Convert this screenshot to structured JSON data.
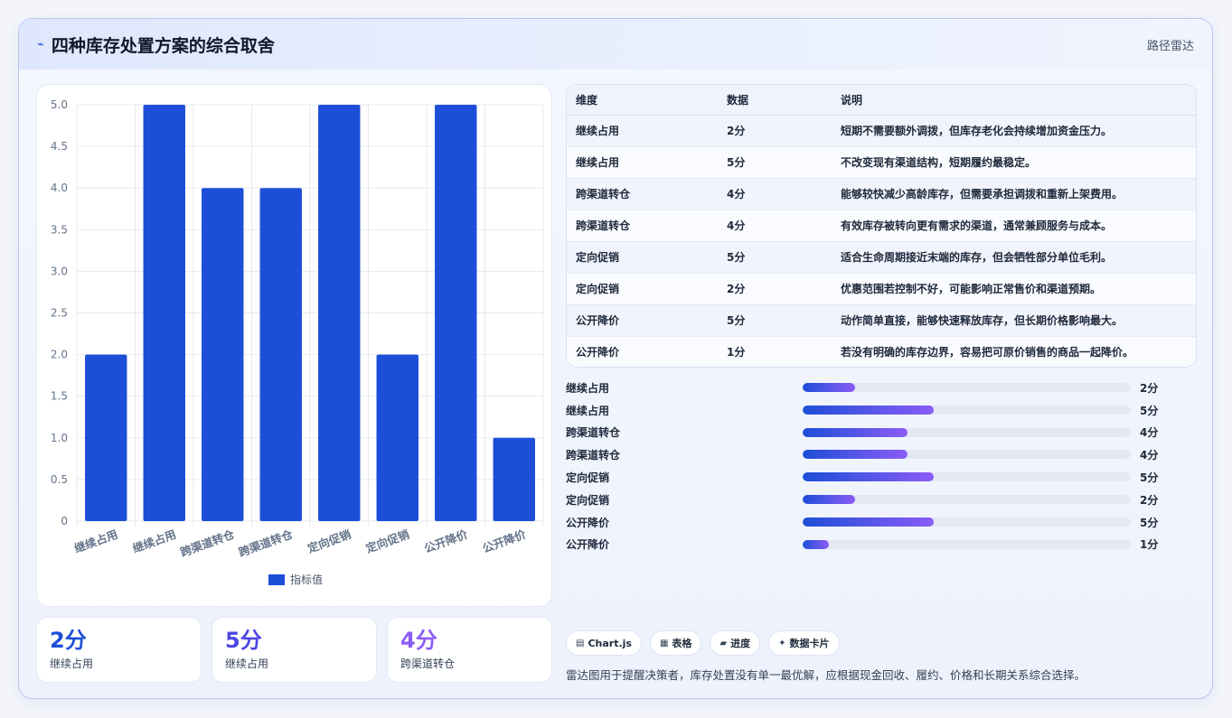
{
  "header": {
    "title": "四种库存处置方案的综合取舍",
    "tag": "路径雷达"
  },
  "chart_data": {
    "type": "bar",
    "categories": [
      "继续占用",
      "继续占用",
      "跨渠道转仓",
      "跨渠道转仓",
      "定向促销",
      "定向促销",
      "公开降价",
      "公开降价"
    ],
    "series": [
      {
        "name": "指标值",
        "values": [
          2,
          5,
          4,
          4,
          5,
          2,
          5,
          1
        ]
      }
    ],
    "ylim": [
      0,
      5
    ],
    "yticks": [
      "0",
      "0.5",
      "1.0",
      "1.5",
      "2.0",
      "2.5",
      "3.0",
      "3.5",
      "4.0",
      "4.5",
      "5.0"
    ],
    "grid": true,
    "legend": "bottom",
    "color": "#1d4ed8"
  },
  "kpis": [
    {
      "value": "2分",
      "label": "继续占用",
      "color": "#1d4ed8"
    },
    {
      "value": "5分",
      "label": "继续占用",
      "color": "#4f46e5"
    },
    {
      "value": "4分",
      "label": "跨渠道转仓",
      "color": "#8b5cf6"
    }
  ],
  "table": {
    "headers": [
      "维度",
      "数据",
      "说明"
    ],
    "rows": [
      [
        "继续占用",
        "2分",
        "短期不需要额外调拨，但库存老化会持续增加资金压力。"
      ],
      [
        "继续占用",
        "5分",
        "不改变现有渠道结构，短期履约最稳定。"
      ],
      [
        "跨渠道转仓",
        "4分",
        "能够较快减少高龄库存，但需要承担调拨和重新上架费用。"
      ],
      [
        "跨渠道转仓",
        "4分",
        "有效库存被转向更有需求的渠道，通常兼顾服务与成本。"
      ],
      [
        "定向促销",
        "5分",
        "适合生命周期接近末端的库存，但会牺牲部分单位毛利。"
      ],
      [
        "定向促销",
        "2分",
        "优惠范围若控制不好，可能影响正常售价和渠道预期。"
      ],
      [
        "公开降价",
        "5分",
        "动作简单直接，能够快速释放库存，但长期价格影响最大。"
      ],
      [
        "公开降价",
        "1分",
        "若没有明确的库存边界，容易把可原价销售的商品一起降价。"
      ]
    ]
  },
  "progress": [
    {
      "label": "继续占用",
      "value": 2,
      "text": "2分"
    },
    {
      "label": "继续占用",
      "value": 5,
      "text": "5分"
    },
    {
      "label": "跨渠道转仓",
      "value": 4,
      "text": "4分"
    },
    {
      "label": "跨渠道转仓",
      "value": 4,
      "text": "4分"
    },
    {
      "label": "定向促销",
      "value": 5,
      "text": "5分"
    },
    {
      "label": "定向促销",
      "value": 2,
      "text": "2分"
    },
    {
      "label": "公开降价",
      "value": 5,
      "text": "5分"
    },
    {
      "label": "公开降价",
      "value": 1,
      "text": "1分"
    }
  ],
  "progress_max": 12.5,
  "chips": [
    {
      "icon": "chart-icon",
      "glyph": "▤",
      "label": "Chart.js"
    },
    {
      "icon": "table-icon",
      "glyph": "▦",
      "label": "表格"
    },
    {
      "icon": "progress-icon",
      "glyph": "▰",
      "label": "进度"
    },
    {
      "icon": "spark-icon",
      "glyph": "✦",
      "label": "数据卡片"
    }
  ],
  "footnote": "雷达图用于提醒决策者，库存处置没有单一最优解，应根据现金回收、履约、价格和长期关系综合选择。"
}
